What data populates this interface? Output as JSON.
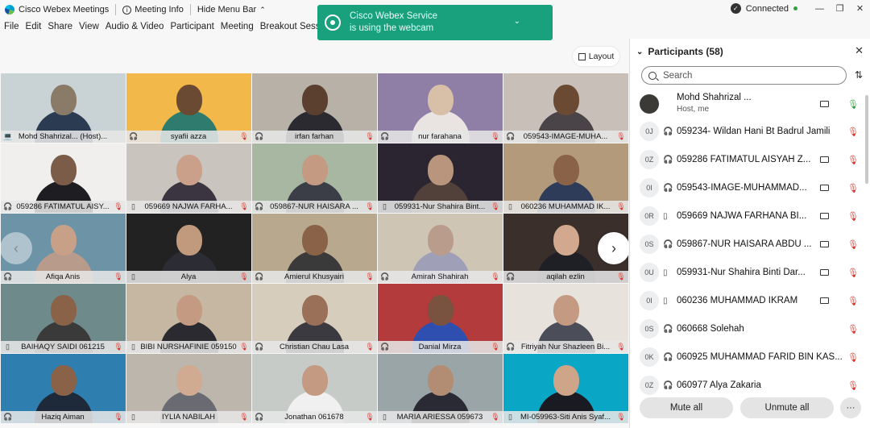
{
  "titlebar": {
    "app_title": "Cisco Webex Meetings",
    "meeting_info": "Meeting Info",
    "hide_menu_bar": "Hide Menu Bar",
    "connection_status": "Connected"
  },
  "menu": [
    "File",
    "Edit",
    "Share",
    "View",
    "Audio & Video",
    "Participant",
    "Meeting",
    "Breakout Sessions"
  ],
  "toast": {
    "line1": "Cisco Webex Service",
    "line2": "is using the webcam",
    "color": "#19a07c"
  },
  "layout_button": "Layout",
  "tiles": [
    {
      "name": "Mohd Shahrizal... (Host)...",
      "icon": "computer",
      "muted": false
    },
    {
      "name": "syafii azza",
      "icon": "headset",
      "muted": true
    },
    {
      "name": "irfan farhan",
      "icon": "headset",
      "muted": true
    },
    {
      "name": "nur farahana",
      "icon": "headset",
      "muted": true
    },
    {
      "name": "059543-IMAGE-MUHA...",
      "icon": "headset",
      "muted": true
    },
    {
      "name": "059286 FATIMATUL AISY...",
      "icon": "headset",
      "muted": true
    },
    {
      "name": "059669 NAJWA FARHA...",
      "icon": "phone",
      "muted": true
    },
    {
      "name": "059867-NUR HAISARA ...",
      "icon": "headset",
      "muted": true
    },
    {
      "name": "059931-Nur Shahira Bint...",
      "icon": "phone",
      "muted": true
    },
    {
      "name": "060236 MUHAMMAD IK...",
      "icon": "phone",
      "muted": true
    },
    {
      "name": "Afiqa Anis",
      "icon": "headset",
      "muted": true
    },
    {
      "name": "Alya",
      "icon": "phone",
      "muted": true
    },
    {
      "name": "Amierul Khusyairi",
      "icon": "headset",
      "muted": true
    },
    {
      "name": "Amirah Shahirah",
      "icon": "headset",
      "muted": true
    },
    {
      "name": "aqilah ezlin",
      "icon": "headset",
      "muted": true
    },
    {
      "name": "BAIHAQY SAIDI 061215",
      "icon": "phone",
      "muted": true
    },
    {
      "name": "BIBI NURSHAFINIE 059150",
      "icon": "phone",
      "muted": true
    },
    {
      "name": "Christian Chau Lasa",
      "icon": "headset",
      "muted": true
    },
    {
      "name": "Danial Mirza",
      "icon": "headset",
      "muted": true
    },
    {
      "name": "Fitriyah Nur Shazleen Bi...",
      "icon": "headset",
      "muted": true
    },
    {
      "name": "Haziq Aiman",
      "icon": "headset",
      "muted": true
    },
    {
      "name": "IYLIA NABILAH",
      "icon": "phone",
      "muted": true
    },
    {
      "name": "Jonathan 061678",
      "icon": "headset",
      "muted": true
    },
    {
      "name": "MARIA ARIESSA 059673",
      "icon": "phone",
      "muted": true
    },
    {
      "name": "MI-059963-Siti Anis Syaf...",
      "icon": "phone",
      "muted": true
    }
  ],
  "participants_panel": {
    "title": "Participants (58)",
    "search_placeholder": "Search",
    "host": {
      "name": "Mohd Shahrizal ...",
      "role": "Host, me"
    },
    "rows": [
      {
        "initials": "0J",
        "device": "headset",
        "name": "059234- Wildan Hani Bt Badrul Jamili",
        "video": false
      },
      {
        "initials": "0Z",
        "device": "headset",
        "name": "059286 FATIMATUL AISYAH Z...",
        "video": true
      },
      {
        "initials": "0I",
        "device": "headset",
        "name": "059543-IMAGE-MUHAMMAD...",
        "video": true
      },
      {
        "initials": "0R",
        "device": "phone",
        "name": "059669 NAJWA FARHANA BI...",
        "video": true
      },
      {
        "initials": "0S",
        "device": "headset",
        "name": "059867-NUR HAISARA ABDU ...",
        "video": true
      },
      {
        "initials": "0U",
        "device": "phone",
        "name": "059931-Nur Shahira Binti Dar...",
        "video": true
      },
      {
        "initials": "0I",
        "device": "phone",
        "name": "060236 MUHAMMAD IKRAM",
        "video": true
      },
      {
        "initials": "0S",
        "device": "headset",
        "name": "060668 Solehah",
        "video": false
      },
      {
        "initials": "0K",
        "device": "headset",
        "name": "060925 MUHAMMAD FARID BIN KAS...",
        "video": false
      },
      {
        "initials": "0Z",
        "device": "headset",
        "name": "060977 Alya Zakaria",
        "video": false
      }
    ],
    "mute_all": "Mute all",
    "unmute_all": "Unmute all",
    "more": "···"
  }
}
